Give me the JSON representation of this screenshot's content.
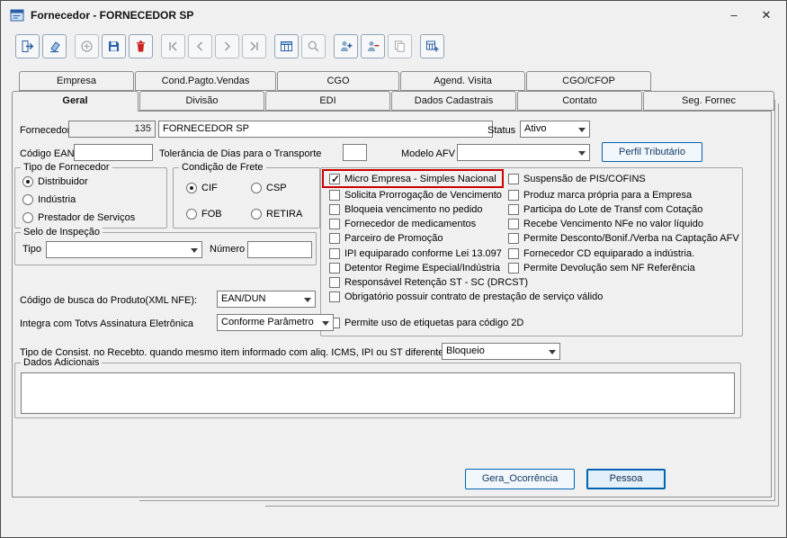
{
  "window": {
    "title": "Fornecedor - FORNECEDOR SP",
    "minimize_glyph": "–",
    "close_glyph": "✕"
  },
  "colors": {
    "accent_blue": "#0063b1",
    "icon_blue": "#2b5fa5",
    "icon_red": "#cc2222",
    "highlight_red": "#cc0000"
  },
  "toolbar": {
    "buttons": [
      {
        "name": "exit",
        "enabled": true
      },
      {
        "name": "clear",
        "enabled": true
      },
      {
        "name": "add",
        "enabled": false
      },
      {
        "name": "save",
        "enabled": true
      },
      {
        "name": "delete",
        "enabled": true
      },
      {
        "name": "first",
        "enabled": false
      },
      {
        "name": "previous",
        "enabled": false
      },
      {
        "name": "next",
        "enabled": false
      },
      {
        "name": "last",
        "enabled": false
      },
      {
        "name": "table-view",
        "enabled": true
      },
      {
        "name": "search",
        "enabled": false
      },
      {
        "name": "add-user",
        "enabled": true
      },
      {
        "name": "remove-user",
        "enabled": true
      },
      {
        "name": "copy",
        "enabled": false
      },
      {
        "name": "table-add",
        "enabled": true
      }
    ]
  },
  "tabs": {
    "row1": [
      "Empresa",
      "Cond.Pagto.Vendas",
      "CGO",
      "Agend. Visita",
      "CGO/CFOP"
    ],
    "row2": [
      "Geral",
      "Divisão",
      "EDI",
      "Dados Cadastrais",
      "Contato",
      "Seg. Fornec"
    ],
    "active": "Geral"
  },
  "form": {
    "fornecedor": {
      "label": "Fornecedor",
      "code": "135",
      "name": "FORNECEDOR SP"
    },
    "status": {
      "label": "Status",
      "value": "Ativo"
    },
    "codigo_ean": {
      "label": "Código EAN",
      "value": ""
    },
    "tolerancia": {
      "label": "Tolerância de Dias para o Transporte",
      "value": ""
    },
    "modelo_afv": {
      "label": "Modelo AFV",
      "value": ""
    },
    "perfil_tributario": "Perfil Tributário",
    "tipo_fornecedor": {
      "legend": "Tipo de Fornecedor",
      "options": [
        {
          "label": "Distribuidor",
          "selected": true
        },
        {
          "label": "Indústria",
          "selected": false
        },
        {
          "label": "Prestador de Serviços",
          "selected": false
        }
      ]
    },
    "condicao_frete": {
      "legend": "Condição de Frete",
      "options": [
        {
          "label": "CIF",
          "selected": true
        },
        {
          "label": "CSP",
          "selected": false
        },
        {
          "label": "FOB",
          "selected": false
        },
        {
          "label": "RETIRA",
          "selected": false
        }
      ]
    },
    "checks_col1": [
      {
        "label": "Micro Empresa - Simples Nacional",
        "checked": true,
        "highlighted": true
      },
      {
        "label": "Solicita Prorrogação de Vencimento",
        "checked": false
      },
      {
        "label": "Bloqueia vencimento no pedido",
        "checked": false
      },
      {
        "label": "Fornecedor de medicamentos",
        "checked": false
      },
      {
        "label": "Parceiro de Promoção",
        "checked": false
      },
      {
        "label": "IPI equiparado conforme Lei 13.097",
        "checked": false
      },
      {
        "label": "Detentor Regime Especial/Indústria",
        "checked": false
      },
      {
        "label": "Responsável Retenção ST - SC (DRCST)",
        "checked": false
      },
      {
        "label": "Obrigatório possuir contrato de prestação de serviço válido",
        "checked": false
      }
    ],
    "checks_col2": [
      {
        "label": "Suspensão de PIS/COFINS",
        "checked": false
      },
      {
        "label": "Produz marca própria para a Empresa",
        "checked": false
      },
      {
        "label": "Participa do Lote de Transf com Cotação",
        "checked": false
      },
      {
        "label": "Recebe Vencimento NFe no valor líquido",
        "checked": false
      },
      {
        "label": "Permite Desconto/Bonif./Verba na Captação AFV",
        "checked": false
      },
      {
        "label": "Fornecedor CD equiparado a indústria.",
        "checked": false
      },
      {
        "label": "Permite Devolução sem NF Referência",
        "checked": false
      }
    ],
    "etiquetas_2d": {
      "label": "Permite uso de etiquetas para código 2D",
      "checked": false
    },
    "selo": {
      "legend": "Selo de Inspeção",
      "tipo_label": "Tipo",
      "tipo_value": "",
      "numero_label": "Número",
      "numero_value": ""
    },
    "codigo_busca": {
      "label": "Código de busca do Produto(XML NFE):",
      "value": "EAN/DUN"
    },
    "integra_totvs": {
      "label": "Integra com Totvs Assinatura Eletrônica",
      "value": "Conforme Parâmetro"
    },
    "tipo_consist": {
      "label": "Tipo de Consist. no Recebto. quando mesmo item informado com aliq. ICMS, IPI ou ST diferentes:",
      "value": "Bloqueio"
    },
    "dados_adicionais": {
      "legend": "Dados Adicionais",
      "value": ""
    },
    "actions": {
      "gera_ocorrencia": "Gera_Ocorrência",
      "pessoa": "Pessoa"
    }
  }
}
